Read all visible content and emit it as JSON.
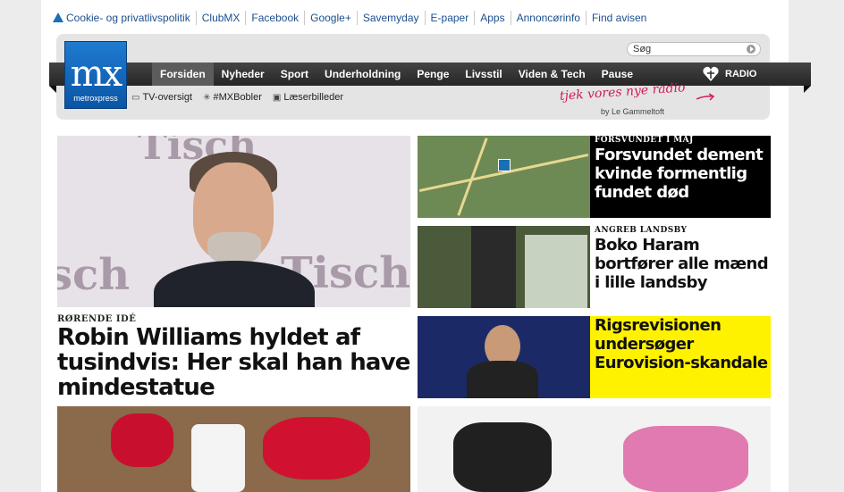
{
  "toplinks": [
    "Cookie- og privatlivspolitik",
    "ClubMX",
    "Facebook",
    "Google+",
    "Savemyday",
    "E-paper",
    "Apps",
    "Annoncørinfo",
    "Find avisen"
  ],
  "search": {
    "value": "Søg"
  },
  "logo": {
    "mark": "mx",
    "sub": "metroxpress"
  },
  "nav": {
    "items": [
      "Forsiden",
      "Nyheder",
      "Sport",
      "Underholdning",
      "Penge",
      "Livsstil",
      "Viden & Tech",
      "Pause"
    ],
    "active": "Forsiden",
    "radio": "RADIO"
  },
  "subnav": [
    {
      "icon": "tv-icon",
      "label": "TV-oversigt"
    },
    {
      "icon": "sparkle-icon",
      "label": "#MXBobler"
    },
    {
      "icon": "photo-icon",
      "label": "Læserbilleder"
    }
  ],
  "promo": {
    "text": "tjek vores nye radio",
    "by": "by Le Gammeltoft"
  },
  "main_story": {
    "kicker": "RØRENDE IDÉ",
    "headline": "Robin Williams hyldet af tusindvis: Her skal han have mindestatue"
  },
  "side_stories": [
    {
      "kicker": "FORSVUNDET I MAJ",
      "headline": "Forsvundet dement kvinde formentlig fundet død",
      "style": "dark"
    },
    {
      "kicker": "ANGREB LANDSBY",
      "headline": "Boko Haram bortfører alle mænd i lille landsby",
      "style": "white"
    },
    {
      "kicker": "",
      "headline": "Rigsrevisionen undersøger Eurovision-skandale",
      "style": "yellow"
    }
  ],
  "colors": {
    "brand_blue": "#1a6fb5",
    "nav_bg": "#2e2e2e",
    "highlight_yellow": "#fff200",
    "promo_pink": "#d4175b"
  }
}
